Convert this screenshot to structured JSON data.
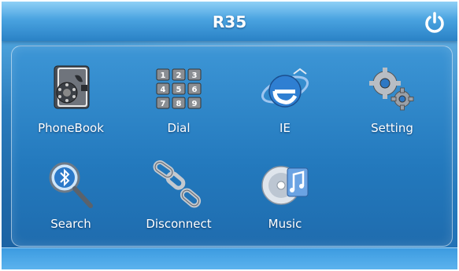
{
  "header": {
    "title": "R35",
    "power_icon": "power-icon"
  },
  "apps": [
    {
      "label": "PhoneBook",
      "icon": "phonebook-icon"
    },
    {
      "label": "Dial",
      "icon": "keypad-icon"
    },
    {
      "label": "IE",
      "icon": "internet-explorer-icon"
    },
    {
      "label": "Setting",
      "icon": "gears-icon"
    },
    {
      "label": "Search",
      "icon": "bluetooth-search-icon"
    },
    {
      "label": "Disconnect",
      "icon": "broken-chain-icon"
    },
    {
      "label": "Music",
      "icon": "music-cd-icon"
    }
  ],
  "keypad": [
    "1",
    "2",
    "3",
    "4",
    "5",
    "6",
    "7",
    "8",
    "9"
  ],
  "colors": {
    "accent": "#2f86c8",
    "title_bar": "#4aa3e0"
  }
}
